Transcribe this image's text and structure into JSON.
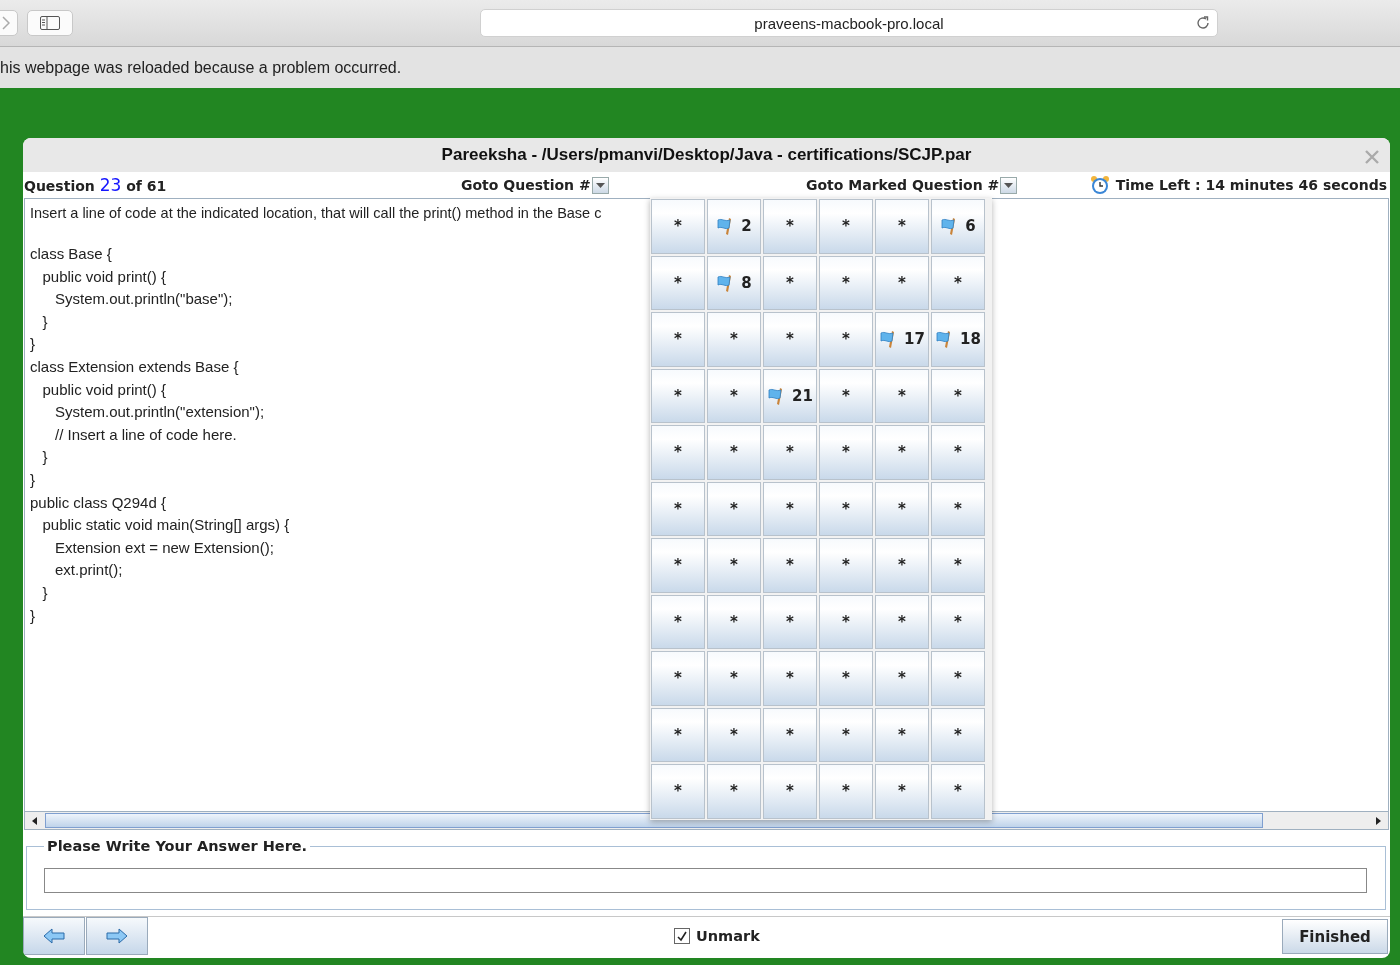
{
  "browser": {
    "address": "praveens-macbook-pro.local",
    "notice": "his webpage was reloaded because a problem occurred."
  },
  "dialog": {
    "title": "Pareeksha - /Users/pmanvi/Desktop/Java - certifications/SCJP.par",
    "header": {
      "question_label": "Question",
      "question_number": "23",
      "question_total": "of 61",
      "goto_label": "Goto Question #",
      "goto_marked_label": "Goto Marked Question #",
      "time_left": "Time Left : 14 minutes 46 seconds"
    },
    "question_text": "Insert a line of code at the indicated location, that will call the print() method in the Base c",
    "code": "class Base {\n   public void print() {\n      System.out.println(\"base\");\n   }\n}\nclass Extension extends Base {\n   public void print() {\n      System.out.println(\"extension\");\n      // Insert a line of code here.\n   }\n}\npublic class Q294d {\n   public static void main(String[] args) {\n      Extension ext = new Extension();\n      ext.print();\n   }\n}",
    "question_grid": [
      {
        "label": "*",
        "marked": false
      },
      {
        "label": "2",
        "marked": true
      },
      {
        "label": "*",
        "marked": false
      },
      {
        "label": "*",
        "marked": false
      },
      {
        "label": "*",
        "marked": false
      },
      {
        "label": "6",
        "marked": true
      },
      {
        "label": "*",
        "marked": false
      },
      {
        "label": "8",
        "marked": true
      },
      {
        "label": "*",
        "marked": false
      },
      {
        "label": "*",
        "marked": false
      },
      {
        "label": "*",
        "marked": false
      },
      {
        "label": "*",
        "marked": false
      },
      {
        "label": "*",
        "marked": false
      },
      {
        "label": "*",
        "marked": false
      },
      {
        "label": "*",
        "marked": false
      },
      {
        "label": "*",
        "marked": false
      },
      {
        "label": "17",
        "marked": true
      },
      {
        "label": "18",
        "marked": true
      },
      {
        "label": "*",
        "marked": false
      },
      {
        "label": "*",
        "marked": false
      },
      {
        "label": "21",
        "marked": true
      },
      {
        "label": "*",
        "marked": false
      },
      {
        "label": "*",
        "marked": false
      },
      {
        "label": "*",
        "marked": false
      },
      {
        "label": "*",
        "marked": false
      },
      {
        "label": "*",
        "marked": false
      },
      {
        "label": "*",
        "marked": false
      },
      {
        "label": "*",
        "marked": false
      },
      {
        "label": "*",
        "marked": false
      },
      {
        "label": "*",
        "marked": false
      },
      {
        "label": "*",
        "marked": false
      },
      {
        "label": "*",
        "marked": false
      },
      {
        "label": "*",
        "marked": false
      },
      {
        "label": "*",
        "marked": false
      },
      {
        "label": "*",
        "marked": false
      },
      {
        "label": "*",
        "marked": false
      },
      {
        "label": "*",
        "marked": false
      },
      {
        "label": "*",
        "marked": false
      },
      {
        "label": "*",
        "marked": false
      },
      {
        "label": "*",
        "marked": false
      },
      {
        "label": "*",
        "marked": false
      },
      {
        "label": "*",
        "marked": false
      },
      {
        "label": "*",
        "marked": false
      },
      {
        "label": "*",
        "marked": false
      },
      {
        "label": "*",
        "marked": false
      },
      {
        "label": "*",
        "marked": false
      },
      {
        "label": "*",
        "marked": false
      },
      {
        "label": "*",
        "marked": false
      },
      {
        "label": "*",
        "marked": false
      },
      {
        "label": "*",
        "marked": false
      },
      {
        "label": "*",
        "marked": false
      },
      {
        "label": "*",
        "marked": false
      },
      {
        "label": "*",
        "marked": false
      },
      {
        "label": "*",
        "marked": false
      },
      {
        "label": "*",
        "marked": false
      },
      {
        "label": "*",
        "marked": false
      },
      {
        "label": "*",
        "marked": false
      },
      {
        "label": "*",
        "marked": false
      },
      {
        "label": "*",
        "marked": false
      },
      {
        "label": "*",
        "marked": false
      },
      {
        "label": "*",
        "marked": false
      },
      {
        "label": "*",
        "marked": false
      },
      {
        "label": "*",
        "marked": false
      },
      {
        "label": "*",
        "marked": false
      },
      {
        "label": "*",
        "marked": false
      },
      {
        "label": "*",
        "marked": false
      }
    ],
    "answer": {
      "legend": "Please Write Your Answer Here."
    },
    "unmark": {
      "label": "Unmark",
      "checked": true
    },
    "finish_button": "Finished"
  }
}
